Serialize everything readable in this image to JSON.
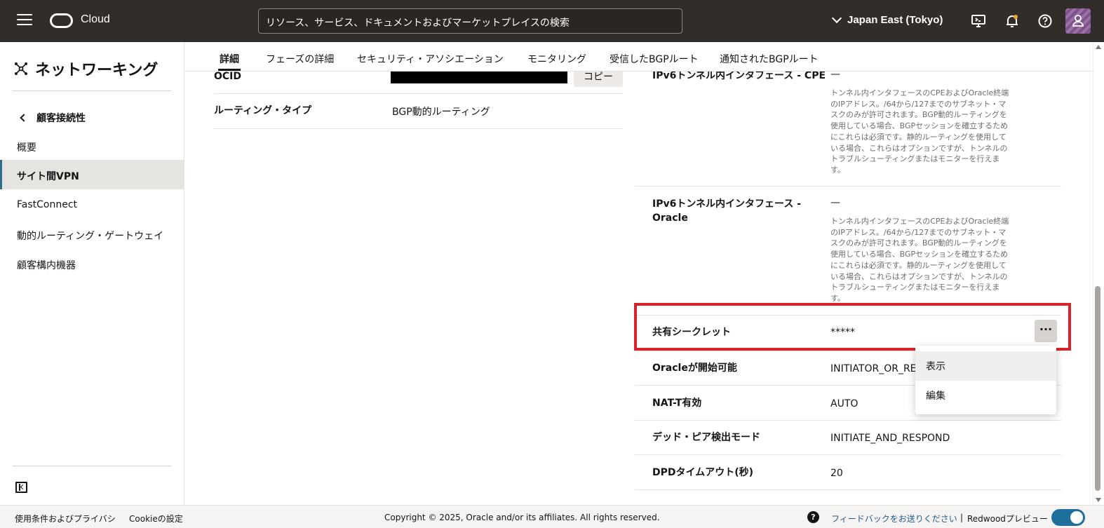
{
  "header": {
    "brand": "Cloud",
    "search_placeholder": "リソース、サービス、ドキュメントおよびマーケットプレイスの検索",
    "region": "Japan East (Tokyo)"
  },
  "sidebar": {
    "title": "ネットワーキング",
    "back_label": "顧客接続性",
    "items": [
      {
        "label": "概要"
      },
      {
        "label": "サイト間VPN",
        "active": true
      },
      {
        "label": "FastConnect"
      },
      {
        "label": "動的ルーティング・ゲートウェイ"
      },
      {
        "label": "顧客構内機器"
      }
    ]
  },
  "tabs": [
    {
      "label": "詳細",
      "active": true
    },
    {
      "label": "フェーズの詳細"
    },
    {
      "label": "セキュリティ・アソシエーション"
    },
    {
      "label": "モニタリング"
    },
    {
      "label": "受信したBGPルート"
    },
    {
      "label": "通知されたBGPルート"
    }
  ],
  "left_details": {
    "ocid_label": "OCID",
    "copy_label": "コピー",
    "routing_label": "ルーティング・タイプ",
    "routing_value": "BGP動的ルーティング"
  },
  "right_details": {
    "ipv6_cpe_label": "IPv6トンネル内インタフェース - CPE",
    "ipv6_cpe_value": "—",
    "ipv6_oracle_label_1": "IPv6トンネル内インタフェース -",
    "ipv6_oracle_label_2": "Oracle",
    "ipv6_oracle_value": "—",
    "hint_lines": [
      "トンネル内インタフェースのCPEおよびOracle終端",
      "のIPアドレス。/64から/127までのサブネット・マ",
      "スクのみが許可されます。BGP動的ルーティングを",
      "使用している場合、BGPセッションを確立するため",
      "にこれらは必須です。静的ルーティングを使用して",
      "いる場合、これらはオプションですが、トンネルの",
      "トラブルシューティングまたはモニターを行えま",
      "す。"
    ],
    "shared_secret_label": "共有シークレット",
    "shared_secret_value": "*****",
    "kebab": "···",
    "oracle_init_label": "Oracleが開始可能",
    "oracle_init_value": "INITIATOR_OR_RESP",
    "nat_label": "NAT-T有効",
    "nat_value": "AUTO",
    "dpd_mode_label": "デッド・ピア検出モード",
    "dpd_mode_value": "INITIATE_AND_RESPOND",
    "dpd_timeout_label": "DPDタイムアウト(秒)",
    "dpd_timeout_value": "20"
  },
  "action_menu": {
    "items": [
      {
        "label": "表示"
      },
      {
        "label": "編集"
      }
    ]
  },
  "footer": {
    "terms": "使用条件およびプライバシ",
    "cookie": "Cookieの設定",
    "copyright": "Copyright © 2025, Oracle and/or its affiliates. All rights reserved.",
    "help": "?",
    "feedback": "フィードバックをお送りください",
    "separator": "|",
    "redwood": "Redwoodプレビュー"
  },
  "colors": {
    "topbar": "#312d2a",
    "highlight": "#d8232a",
    "toggle": "#1f6f9d",
    "active_nav": "#e6e4e1"
  }
}
